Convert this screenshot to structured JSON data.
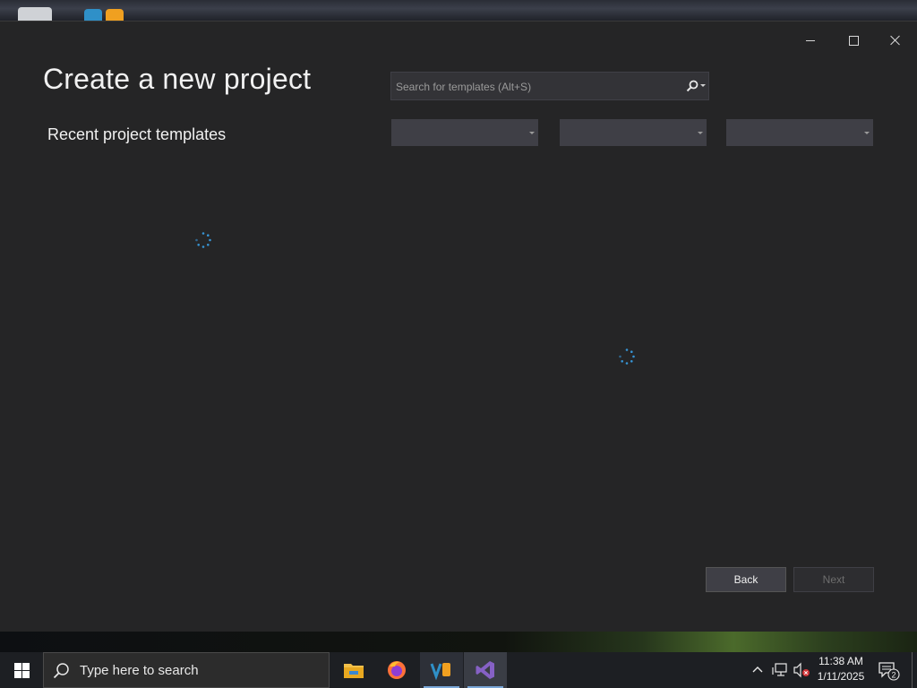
{
  "dialog": {
    "title": "Create a new project",
    "section_title": "Recent project templates",
    "search": {
      "placeholder": "Search for templates (Alt+S)",
      "value": ""
    },
    "filters": [
      {
        "name": "language",
        "selected": ""
      },
      {
        "name": "platform",
        "selected": ""
      },
      {
        "name": "project-type",
        "selected": ""
      }
    ],
    "buttons": {
      "back": "Back",
      "next": "Next"
    },
    "loading": true
  },
  "taskbar": {
    "search_placeholder": "Type here to search",
    "apps": [
      "file-explorer-icon",
      "firefox-icon",
      "app-icon",
      "visual-studio-icon"
    ],
    "clock": {
      "time": "11:38 AM",
      "date": "1/11/2025"
    },
    "notification_count": "2"
  },
  "colors": {
    "window_bg": "#252526",
    "accent_spinner": "#3794d4",
    "taskbar_bg": "#1d1f23",
    "vs_purple": "#8661c5"
  }
}
